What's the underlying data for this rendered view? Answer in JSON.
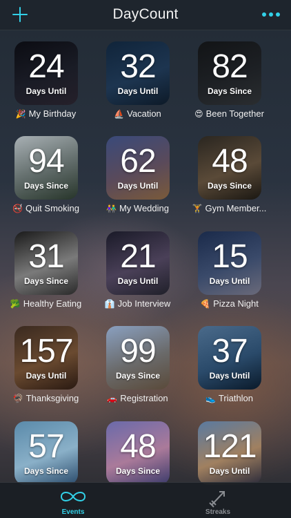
{
  "nav": {
    "title": "DayCount",
    "left_icon": "plus-icon",
    "right_icon": "more-icon"
  },
  "colors": {
    "accent": "#32d1e8",
    "inactive": "#8a8d92"
  },
  "events": [
    {
      "number": "24",
      "status": "Days Until",
      "emoji": "🎉",
      "name": "My Birthday",
      "bg": [
        "#0b0c12",
        "#1a1c26",
        "#25202a"
      ]
    },
    {
      "number": "32",
      "status": "Days Until",
      "emoji": "⛵",
      "name": "Vacation",
      "bg": [
        "#10243a",
        "#1d3550",
        "#0d1a28"
      ]
    },
    {
      "number": "82",
      "status": "Days Since",
      "emoji": "😍",
      "name": "Been Together",
      "bg": [
        "#121416",
        "#1d2024",
        "#2a2d30"
      ]
    },
    {
      "number": "94",
      "status": "Days Since",
      "emoji": "🚭",
      "name": "Quit Smoking",
      "bg": [
        "#a8b0b4",
        "#5f6a68",
        "#27352a"
      ]
    },
    {
      "number": "62",
      "status": "Days Until",
      "emoji": "👫",
      "name": "My Wedding",
      "bg": [
        "#3a4a7a",
        "#5a4a5a",
        "#7a5a3a"
      ]
    },
    {
      "number": "48",
      "status": "Days Since",
      "emoji": "🏋",
      "name": "Gym Member...",
      "bg": [
        "#2a2620",
        "#5a4a38",
        "#1a1712"
      ]
    },
    {
      "number": "31",
      "status": "Days Since",
      "emoji": "🥦",
      "name": "Healthy Eating",
      "bg": [
        "#1a1a1a",
        "#7a7a7a",
        "#2a2a2a"
      ]
    },
    {
      "number": "21",
      "status": "Days Until",
      "emoji": "👔",
      "name": "Job Interview",
      "bg": [
        "#1a1a28",
        "#4a4058",
        "#20202a"
      ]
    },
    {
      "number": "15",
      "status": "Days Until",
      "emoji": "🍕",
      "name": "Pizza Night",
      "bg": [
        "#1a2a4a",
        "#3a4a6a",
        "#6a6a7a"
      ]
    },
    {
      "number": "157",
      "status": "Days Until",
      "emoji": "🦃",
      "name": "Thanksgiving",
      "bg": [
        "#3a2a20",
        "#6a4a30",
        "#2a1a12"
      ]
    },
    {
      "number": "99",
      "status": "Days Since",
      "emoji": "🚗",
      "name": "Registration",
      "bg": [
        "#8aa0c0",
        "#6a6a6a",
        "#5a4a3a"
      ]
    },
    {
      "number": "37",
      "status": "Days Until",
      "emoji": "👟",
      "name": "Triathlon",
      "bg": [
        "#4a6a8a",
        "#2a4a6a",
        "#0a1a2a"
      ]
    },
    {
      "number": "57",
      "status": "Days Since",
      "emoji": "",
      "name": "",
      "bg": [
        "#5a8aaa",
        "#8ab0c8",
        "#2a4a6a"
      ]
    },
    {
      "number": "48",
      "status": "Days Since",
      "emoji": "",
      "name": "",
      "bg": [
        "#6a6aaa",
        "#aa7a9a",
        "#3a3a6a"
      ]
    },
    {
      "number": "121",
      "status": "Days Until",
      "emoji": "",
      "name": "",
      "bg": [
        "#5a7aa0",
        "#a08060",
        "#2a2a3a"
      ]
    }
  ],
  "tabs": [
    {
      "label": "Events",
      "icon": "infinity-icon",
      "active": true
    },
    {
      "label": "Streaks",
      "icon": "arrow-icon",
      "active": false
    }
  ]
}
